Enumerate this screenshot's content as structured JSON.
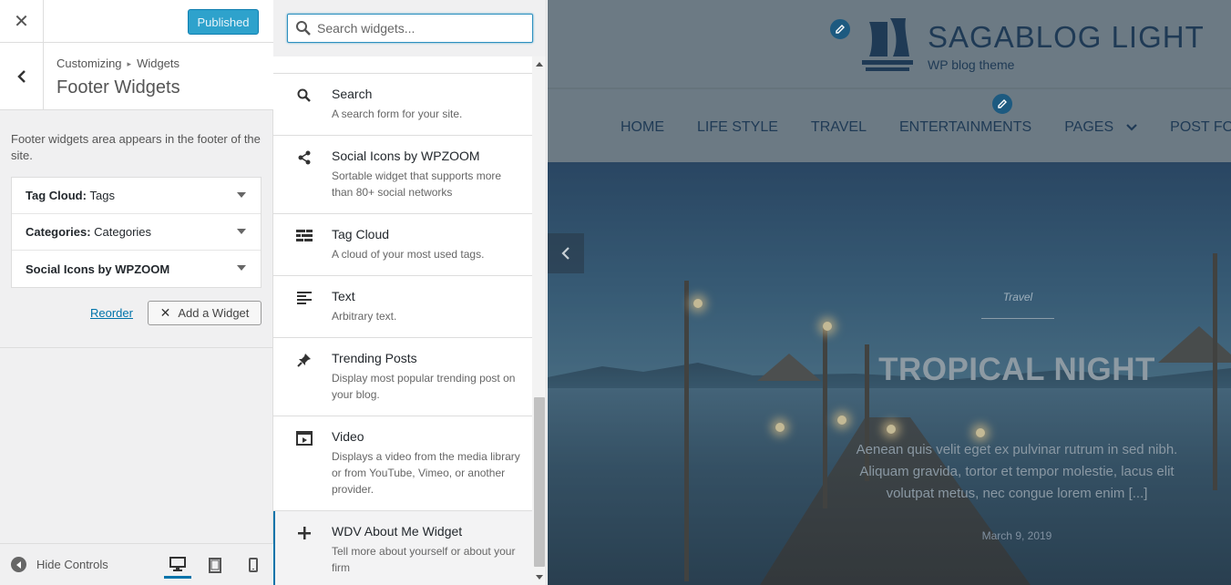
{
  "customizer": {
    "publish_label": "Published",
    "breadcrumb": {
      "root": "Customizing",
      "parent": "Widgets"
    },
    "section_title": "Footer Widgets",
    "description": "Footer widgets area appears in the footer of the site.",
    "widgets": [
      {
        "type": "Tag Cloud:",
        "title": "Tags"
      },
      {
        "type": "Categories:",
        "title": "Categories"
      },
      {
        "type": "Social Icons by WPZOOM",
        "title": ""
      }
    ],
    "reorder_label": "Reorder",
    "add_widget_label": "Add a Widget",
    "hide_controls_label": "Hide Controls",
    "active_device": "desktop"
  },
  "available_widgets": {
    "search_placeholder": "Search widgets...",
    "items": [
      {
        "icon": "search-icon",
        "name": "Search",
        "desc": "A search form for your site."
      },
      {
        "icon": "share-icon",
        "name": "Social Icons by WPZOOM",
        "desc": "Sortable widget that supports more than 80+ social networks"
      },
      {
        "icon": "tag-cloud-icon",
        "name": "Tag Cloud",
        "desc": "A cloud of your most used tags."
      },
      {
        "icon": "text-icon",
        "name": "Text",
        "desc": "Arbitrary text."
      },
      {
        "icon": "pin-icon",
        "name": "Trending Posts",
        "desc": "Display most popular trending post on your blog."
      },
      {
        "icon": "video-icon",
        "name": "Video",
        "desc": "Displays a video from the media library or from YouTube, Vimeo, or another provider."
      },
      {
        "icon": "plus-icon",
        "name": "WDV About Me Widget",
        "desc": "Tell more about yourself or about your firm"
      }
    ]
  },
  "preview": {
    "site_title": "SAGABLOG LIGHT",
    "tagline": "WP blog theme",
    "nav": [
      "HOME",
      "LIFE STYLE",
      "TRAVEL",
      "ENTERTAINMENTS",
      "PAGES",
      "POST FOR"
    ],
    "hero": {
      "category": "Travel",
      "title": "TROPICAL NIGHT",
      "excerpt": "Aenean quis velit eget ex pulvinar rutrum in sed nibh. Aliquam gravida, tortor et tempor molestie, lacus elit volutpat metus, nec congue lorem enim [...]",
      "date": "March 9, 2019"
    }
  },
  "colors": {
    "accent": "#0073aa",
    "publish_button": "#2ea2cc",
    "site_title": "#1f3a55"
  }
}
